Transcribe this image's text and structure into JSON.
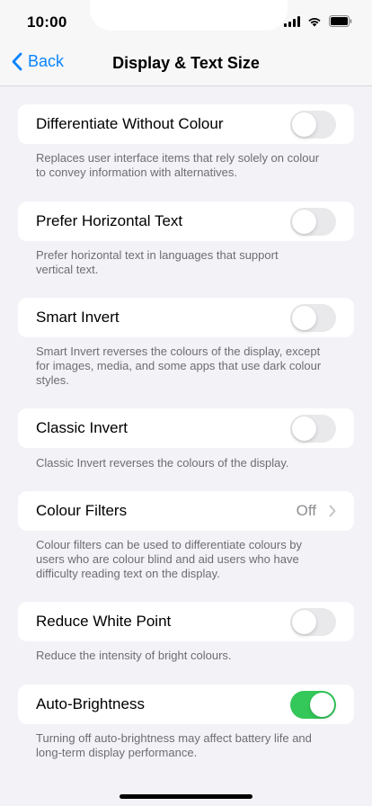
{
  "status_bar": {
    "time": "10:00"
  },
  "nav": {
    "back_label": "Back",
    "title": "Display & Text Size"
  },
  "settings": [
    {
      "label": "Differentiate Without Colour",
      "control": "toggle",
      "on": false,
      "desc_line1": "Replaces user interface items that rely solely on colour",
      "desc_line2": "to convey information with alternatives."
    },
    {
      "label": "Prefer Horizontal Text",
      "control": "toggle",
      "on": false,
      "desc_line1": "Prefer horizontal text in languages that support",
      "desc_line2": "vertical text."
    },
    {
      "label": "Smart Invert",
      "control": "toggle",
      "on": false,
      "desc_line1": "Smart Invert reverses the colours of the display, except",
      "desc_line2": "for images, media, and some apps that use dark colour",
      "desc_line3": "styles."
    },
    {
      "label": "Classic Invert",
      "control": "toggle",
      "on": false,
      "desc_line1": "Classic Invert reverses the colours of the display."
    },
    {
      "label": "Colour Filters",
      "control": "disclosure",
      "value": "Off",
      "desc_line1": "Colour filters can be used to differentiate colours by",
      "desc_line2": "users who are colour blind and aid users who have",
      "desc_line3": "difficulty reading text on the display."
    },
    {
      "label": "Reduce White Point",
      "control": "toggle",
      "on": false,
      "desc_line1": "Reduce the intensity of bright colours."
    },
    {
      "label": "Auto-Brightness",
      "control": "toggle",
      "on": true,
      "desc_line1": "Turning off auto-brightness may affect battery life and",
      "desc_line2": "long-term display performance."
    }
  ],
  "colors": {
    "accent": "#0a84ff",
    "toggle_on": "#34c759",
    "background": "#f2f2f7"
  }
}
